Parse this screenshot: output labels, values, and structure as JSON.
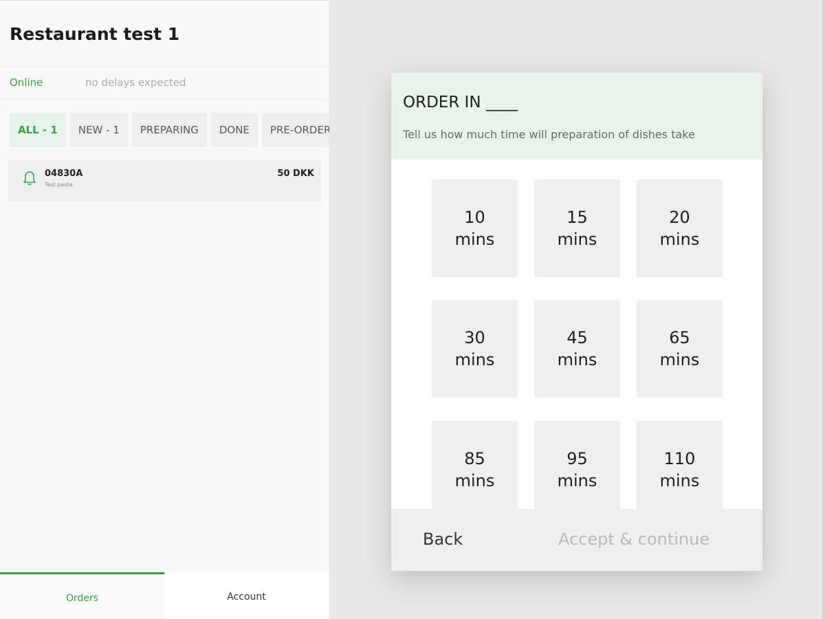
{
  "restaurant": {
    "name": "Restaurant test 1"
  },
  "status": {
    "state": "Online",
    "delay": "no delays expected"
  },
  "tabs": [
    {
      "label": "ALL - 1",
      "active": true
    },
    {
      "label": "NEW - 1",
      "active": false
    },
    {
      "label": "PREPARING",
      "active": false
    },
    {
      "label": "DONE",
      "active": false
    },
    {
      "label": "PRE-ORDERS",
      "active": false
    }
  ],
  "order": {
    "id": "04830A",
    "subtitle": "Test pasta",
    "price": "50 DKK",
    "icon": "bell-icon"
  },
  "nav": {
    "orders": "Orders",
    "account": "Account"
  },
  "dialog": {
    "title": "ORDER IN ____",
    "subtitle": "Tell us how much time will preparation of dishes take",
    "times": [
      {
        "value": "10",
        "unit": "mins"
      },
      {
        "value": "15",
        "unit": "mins"
      },
      {
        "value": "20",
        "unit": "mins"
      },
      {
        "value": "30",
        "unit": "mins"
      },
      {
        "value": "45",
        "unit": "mins"
      },
      {
        "value": "65",
        "unit": "mins"
      },
      {
        "value": "85",
        "unit": "mins"
      },
      {
        "value": "95",
        "unit": "mins"
      },
      {
        "value": "110",
        "unit": "mins"
      }
    ],
    "back": "Back",
    "accept": "Accept & continue"
  },
  "colors": {
    "accent": "#3aa043",
    "header_bg": "#e7f3ec"
  }
}
